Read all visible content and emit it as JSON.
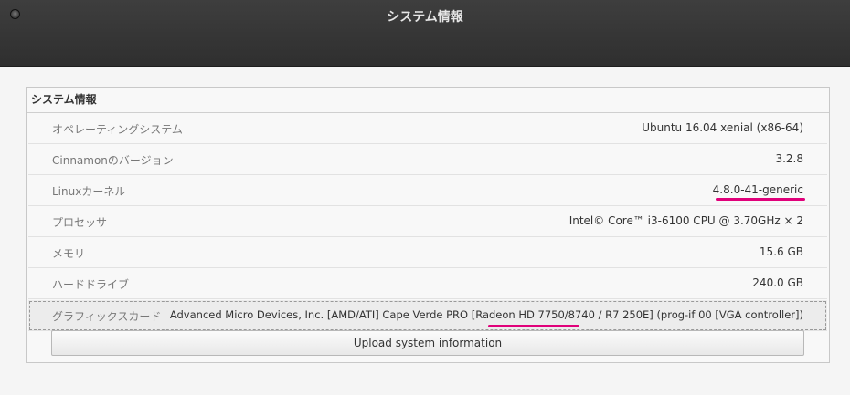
{
  "window": {
    "title": "システム情報"
  },
  "section": {
    "title": "システム情報"
  },
  "rows": [
    {
      "label": "オペレーティングシステム",
      "value": "Ubuntu 16.04 xenial (x86-64)"
    },
    {
      "label": "Cinnamonのバージョン",
      "value": "3.2.8"
    },
    {
      "label": "Linuxカーネル",
      "value": "4.8.0-41-generic"
    },
    {
      "label": "プロセッサ",
      "value": "Intel© Core™ i3-6100 CPU @ 3.70GHz × 2"
    },
    {
      "label": "メモリ",
      "value": "15.6 GB"
    },
    {
      "label": "ハードドライブ",
      "value": "240.0 GB"
    },
    {
      "label": "グラフィックスカード",
      "value": "Advanced Micro Devices, Inc. [AMD/ATI] Cape Verde PRO [Radeon HD 7750/8740 / R7 250E] (prog-if 00 [VGA controller])"
    }
  ],
  "upload_button": {
    "label": "Upload system information"
  },
  "colors": {
    "highlight_underline": "#e0007a",
    "titlebar": "#353535"
  }
}
